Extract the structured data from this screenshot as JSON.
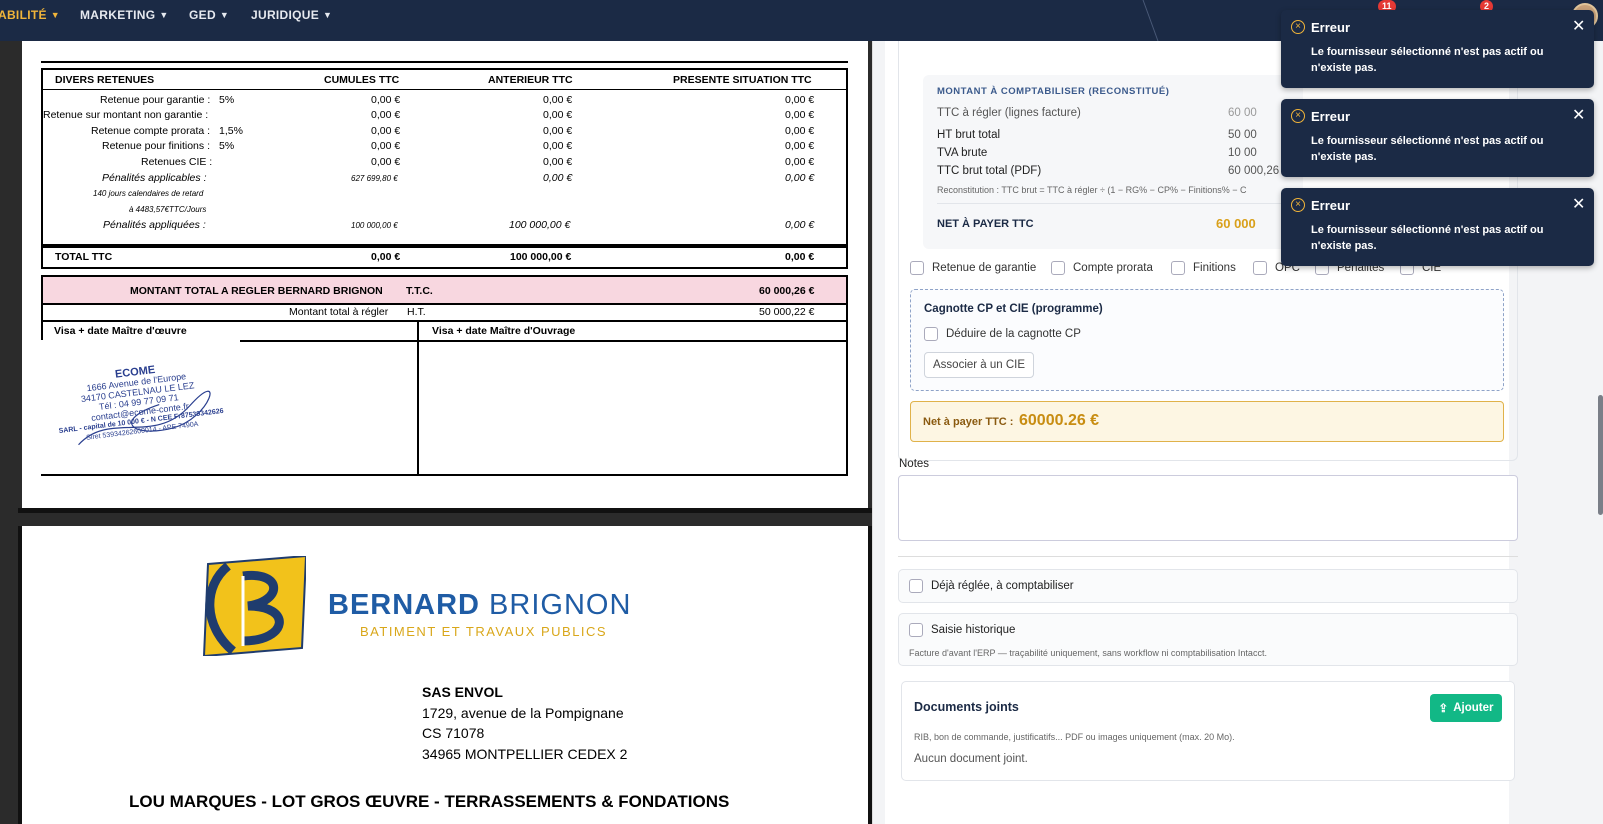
{
  "nav": {
    "items": [
      {
        "label": "ABILITÉ",
        "active": true
      },
      {
        "label": "MARKETING",
        "active": false
      },
      {
        "label": "GED",
        "active": false
      },
      {
        "label": "JURIDIQUE",
        "active": false
      }
    ],
    "badges": [
      "11",
      "2"
    ]
  },
  "pdf": {
    "retenues": {
      "headers": [
        "DIVERS RETENUES",
        "CUMULES TTC",
        "ANTERIEUR TTC",
        "PRESENTE SITUATION TTC"
      ],
      "rows": [
        {
          "label": "Retenue pour garantie :",
          "pct": "5%",
          "cumul": "0,00 €",
          "ant": "0,00 €",
          "pres": "0,00 €"
        },
        {
          "label": "Retenue sur montant non garantie :",
          "pct": "",
          "cumul": "0,00 €",
          "ant": "0,00 €",
          "pres": "0,00 €"
        },
        {
          "label": "Retenue compte prorata :",
          "pct": "1,5%",
          "cumul": "0,00 €",
          "ant": "0,00 €",
          "pres": "0,00 €"
        },
        {
          "label": "Retenue pour finitions :",
          "pct": "5%",
          "cumul": "0,00 €",
          "ant": "0,00 €",
          "pres": "0,00 €"
        },
        {
          "label": "Retenues CIE :",
          "pct": "",
          "cumul": "0,00 €",
          "ant": "0,00 €",
          "pres": "0,00 €"
        }
      ],
      "penalites_applicables": {
        "label": "Pénalités applicables :",
        "cumul": "627 699,80 €",
        "ant": "0,00 €",
        "pres": "0,00 €"
      },
      "retard_line1": "140 jours calendaires de retard",
      "retard_line2": "à 4483,57€TTC/Jours",
      "penalites_appliquees": {
        "label": "Pénalités appliquées :",
        "cumul": "100 000,00 €",
        "ant": "100 000,00 €",
        "pres": "0,00 €"
      },
      "total": {
        "label": "TOTAL TTC",
        "cumul": "0,00 €",
        "ant": "100 000,00 €",
        "pres": "0,00 €"
      }
    },
    "montant_total": {
      "label": "MONTANT TOTAL A REGLER BERNARD BRIGNON",
      "unit": "T.T.C.",
      "value": "60 000,26 €"
    },
    "montant_ht": {
      "label": "Montant total à régler",
      "unit": "H.T.",
      "value": "50 000,22 €"
    },
    "visa_moe": "Visa + date Maître d'œuvre",
    "visa_mo": "Visa + date Maître d'Ouvrage",
    "stamp": {
      "name": "ECOME",
      "line1": "1666 Avenue de l'Europe",
      "line2": "34170 CASTELNAU LE LEZ",
      "line3": "Tél : 04 99 77 09 71",
      "line4": "contact@ecome-conte.fr",
      "line5": "SARL - capital de 10 000 € - N CEE Fr87539342626",
      "line6": "Siret 53934262600014 - APE 7490A"
    },
    "brand_bold": "BERNARD",
    "brand_light": " BRIGNON",
    "brand_sub": "BATIMENT ET TRAVAUX PUBLICS",
    "address": [
      "SAS ENVOL",
      "1729, avenue de la Pompignane",
      "CS 71078",
      "34965 MONTPELLIER CEDEX 2"
    ],
    "lot": "LOU MARQUES - LOT GROS ŒUVRE - TERRASSEMENTS & FONDATIONS"
  },
  "form": {
    "compta": {
      "title": "MONTANT À COMPTABILISER (RECONSTITUÉ)",
      "rows": [
        {
          "label": "TTC à régler (lignes facture)",
          "value": "60 00"
        },
        {
          "label": "HT brut total",
          "value": "50 00"
        },
        {
          "label": "TVA brute",
          "value": "10 00"
        },
        {
          "label": "TTC brut total (PDF)",
          "value": "60 000,26 €"
        }
      ],
      "note": "Reconstitution : TTC brut = TTC à régler ÷ (1 − RG% − CP% − Finitions% − C",
      "net_label": "NET À PAYER TTC",
      "net_value": "60 000"
    },
    "checkboxes": [
      "Retenue de garantie",
      "Compte prorata",
      "Finitions",
      "OPC",
      "Pénalités",
      "CIE"
    ],
    "cagnotte": {
      "title": "Cagnotte CP et CIE (programme)",
      "checkbox": "Déduire de la cagnotte CP",
      "button": "Associer à un CIE"
    },
    "net": {
      "label": "Net à payer TTC :",
      "value": "60000.26 €"
    },
    "notes_label": "Notes",
    "deja_reglee": "Déjà réglée, à comptabiliser",
    "saisie_hist": "Saisie historique",
    "saisie_hist_sub": "Facture d'avant l'ERP — traçabilité uniquement, sans workflow ni comptabilisation Intacct.",
    "docs": {
      "title": "Documents joints",
      "button": "Ajouter",
      "sub": "RIB, bon de commande, justificatifs... PDF ou images uniquement (max. 20 Mo).",
      "none": "Aucun document joint."
    }
  },
  "toasts": [
    {
      "title": "Erreur",
      "message": "Le fournisseur sélectionné n'est pas actif ou n'existe pas."
    },
    {
      "title": "Erreur",
      "message": "Le fournisseur sélectionné n'est pas actif ou n'existe pas."
    },
    {
      "title": "Erreur",
      "message": "Le fournisseur sélectionné n'est pas actif ou n'existe pas."
    }
  ],
  "colors": {
    "nav_bg": "#1b2a45",
    "accent": "#f0b43a",
    "success": "#12b886",
    "pink": "#f8d7e0"
  }
}
